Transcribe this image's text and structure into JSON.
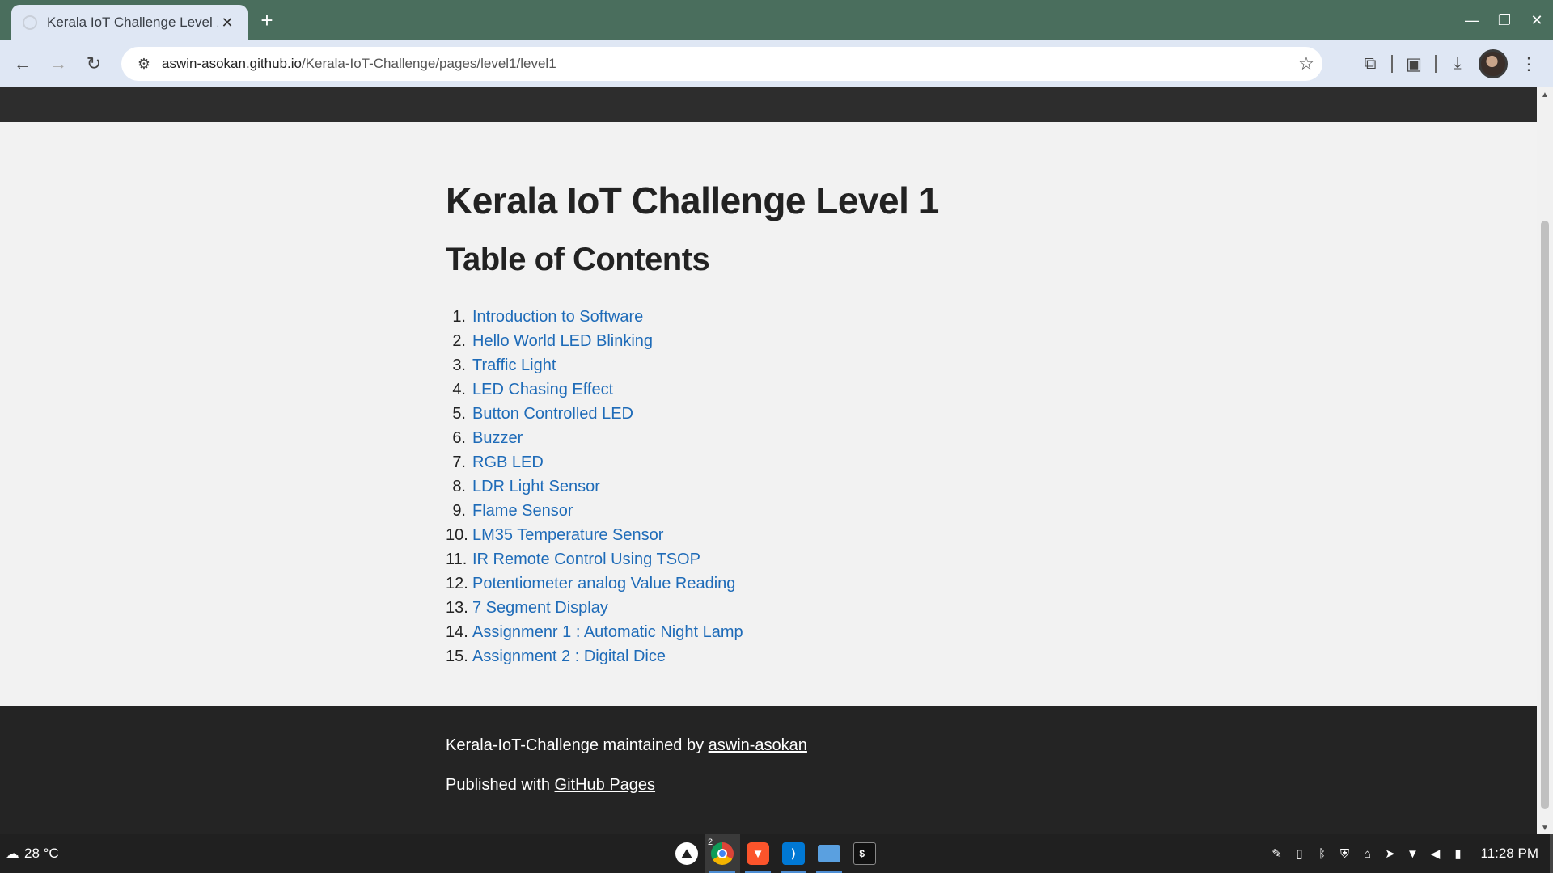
{
  "browser": {
    "tab_title": "Kerala IoT Challenge Level 1",
    "tab_close": "✕",
    "new_tab": "+",
    "url_host": "aswin-asokan.github.io",
    "url_path": "/Kerala-IoT-Challenge/pages/level1/level1"
  },
  "page": {
    "title": "Kerala IoT Challenge Level 1",
    "toc_heading": "Table of Contents",
    "toc": [
      {
        "num": "1.",
        "label": "Introduction to Software"
      },
      {
        "num": "2.",
        "label": "Hello World LED Blinking"
      },
      {
        "num": "3.",
        "label": "Traffic Light"
      },
      {
        "num": "4.",
        "label": "LED Chasing Effect"
      },
      {
        "num": "5.",
        "label": "Button Controlled LED"
      },
      {
        "num": "6.",
        "label": "Buzzer"
      },
      {
        "num": "7.",
        "label": "RGB LED"
      },
      {
        "num": "8.",
        "label": "LDR Light Sensor"
      },
      {
        "num": "9.",
        "label": "Flame Sensor"
      },
      {
        "num": "10.",
        "label": "LM35 Temperature Sensor"
      },
      {
        "num": "11.",
        "label": "IR Remote Control Using TSOP"
      },
      {
        "num": "12.",
        "label": "Potentiometer analog Value Reading"
      },
      {
        "num": "13.",
        "label": "7 Segment Display"
      },
      {
        "num": "14.",
        "label": "Assignmenr 1 : Automatic Night Lamp"
      },
      {
        "num": "15.",
        "label": "Assignment 2 : Digital Dice"
      }
    ]
  },
  "footer": {
    "maintained_prefix": "Kerala-IoT-Challenge maintained by ",
    "maintainer_link": "aswin-asokan",
    "published_prefix": "Published with ",
    "pages_link": "GitHub Pages"
  },
  "taskbar": {
    "weather": "28 °C",
    "chrome_badge": "2",
    "time": "11:28 PM"
  },
  "colors": {
    "link": "#1e6bb8",
    "tabbar": "#4a6e5d",
    "footer": "#242424"
  }
}
